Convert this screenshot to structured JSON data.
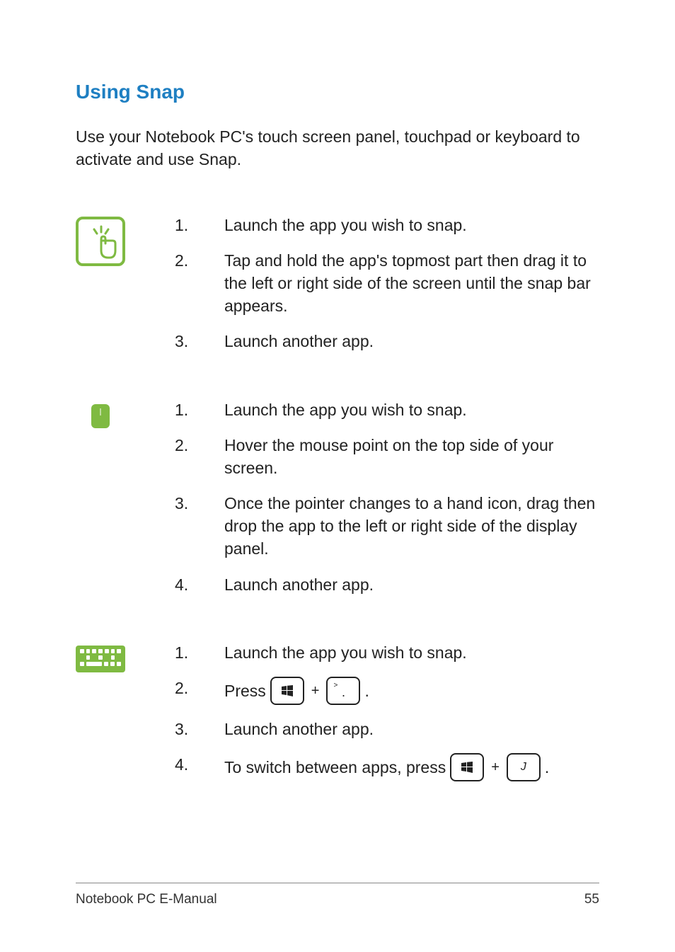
{
  "heading": "Using Snap",
  "intro": "Use your Notebook PC's touch screen panel, touchpad or keyboard to activate and use Snap.",
  "methods": {
    "touch": {
      "steps": [
        "Launch the app you wish to snap.",
        "Tap and hold the app's topmost part then drag it to the left or right side of the screen until the snap bar appears.",
        "Launch another app."
      ]
    },
    "touchpad": {
      "steps": [
        "Launch the app you wish to snap.",
        "Hover the mouse point on the top side of your screen.",
        "Once the pointer changes to a hand icon, drag then drop the app to the left or right side of the display panel.",
        "Launch another app."
      ]
    },
    "keyboard": {
      "step1": "Launch the app you wish to snap.",
      "step2_prefix": "Press",
      "step2_suffix": ".",
      "step3": "Launch another app.",
      "step4_prefix": "To switch between apps, press",
      "step4_suffix": ".",
      "keys": {
        "period_sup": ">",
        "period_main": ".",
        "j": "J"
      }
    }
  },
  "plus": "+",
  "footer": {
    "title": "Notebook PC E-Manual",
    "page": "55"
  }
}
